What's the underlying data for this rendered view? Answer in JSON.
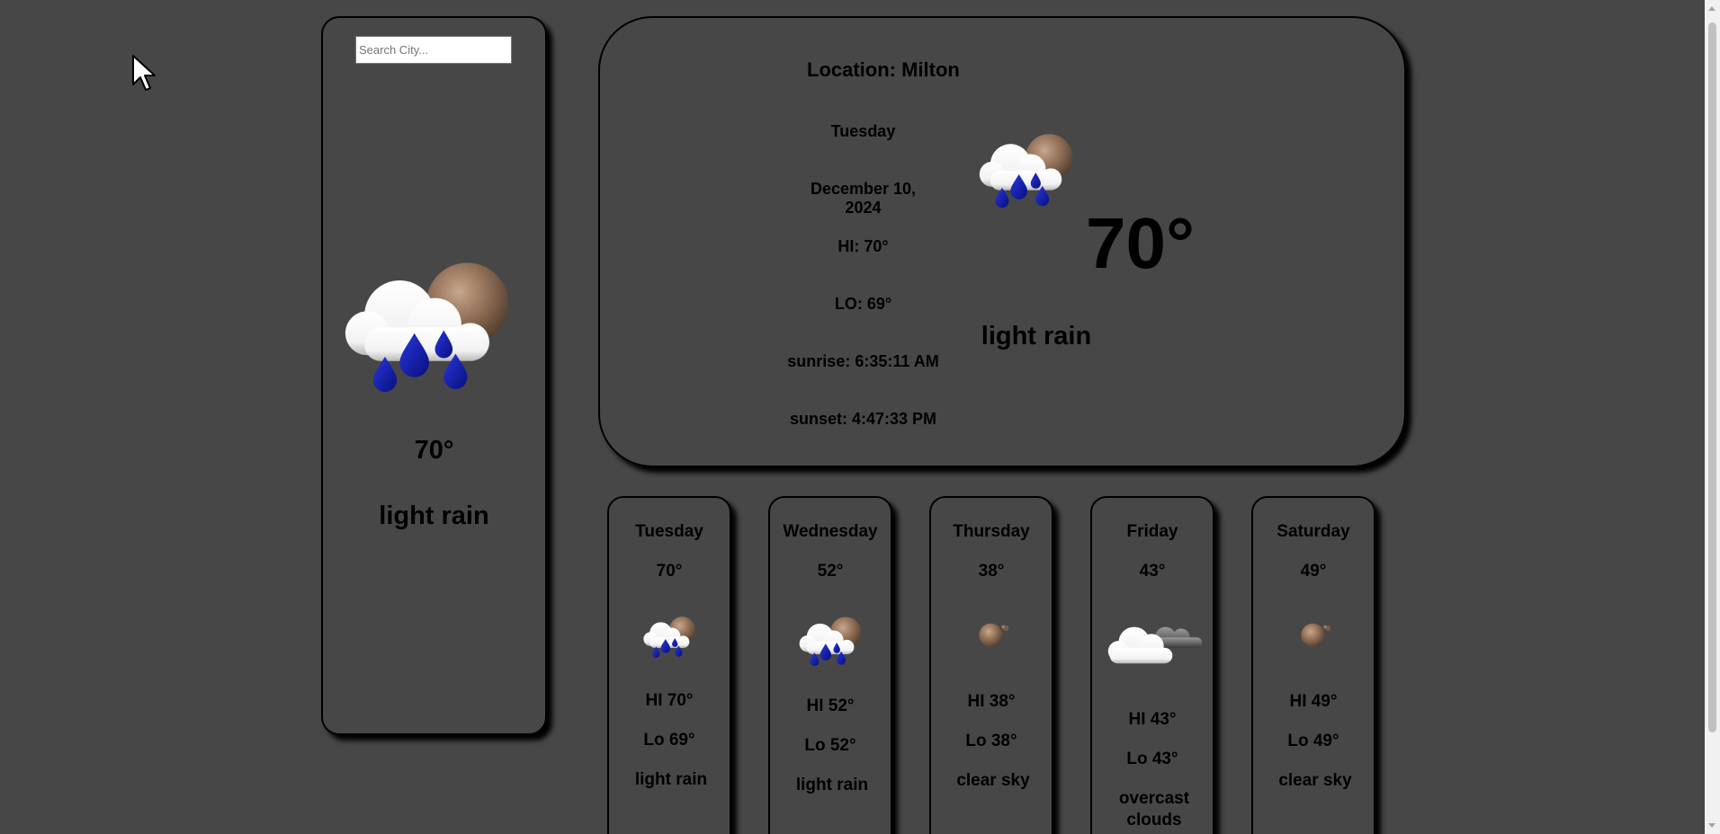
{
  "search": {
    "placeholder": "Search City..."
  },
  "current": {
    "icon": "rain-cloud-sun-icon",
    "temp": "70°",
    "description": "light rain"
  },
  "main": {
    "location": "Location: Milton",
    "day": "Tuesday",
    "date": "December 10, 2024",
    "hi": "HI: 70°",
    "lo": "LO: 69°",
    "sunrise": "sunrise: 6:35:11 AM",
    "sunset": "sunset: 4:47:33 PM",
    "icon": "rain-cloud-sun-icon",
    "temp": "70°",
    "description": "light rain"
  },
  "forecast": [
    {
      "day": "Tuesday",
      "temp": "70°",
      "icon": "rain-cloud-sun-icon",
      "hi": "HI 70°",
      "lo": "Lo 69°",
      "description": "light rain"
    },
    {
      "day": "Wednesday",
      "temp": "52°",
      "icon": "rain-cloud-sun-icon",
      "hi": "HI 52°",
      "lo": "Lo 52°",
      "description": "light rain"
    },
    {
      "day": "Thursday",
      "temp": "38°",
      "icon": "clear-sky-icon",
      "hi": "HI 38°",
      "lo": "Lo 38°",
      "description": "clear sky"
    },
    {
      "day": "Friday",
      "temp": "43°",
      "icon": "overcast-clouds-icon",
      "hi": "HI 43°",
      "lo": "Lo 43°",
      "description": "overcast clouds"
    },
    {
      "day": "Saturday",
      "temp": "49°",
      "icon": "clear-sky-icon",
      "hi": "HI 49°",
      "lo": "Lo 49°",
      "description": "clear sky"
    }
  ],
  "colors": {
    "background": "#474747",
    "border": "#000000",
    "raindrop": "#0a14a8",
    "sun": "#8a6a52",
    "cloud": "#ffffff"
  }
}
